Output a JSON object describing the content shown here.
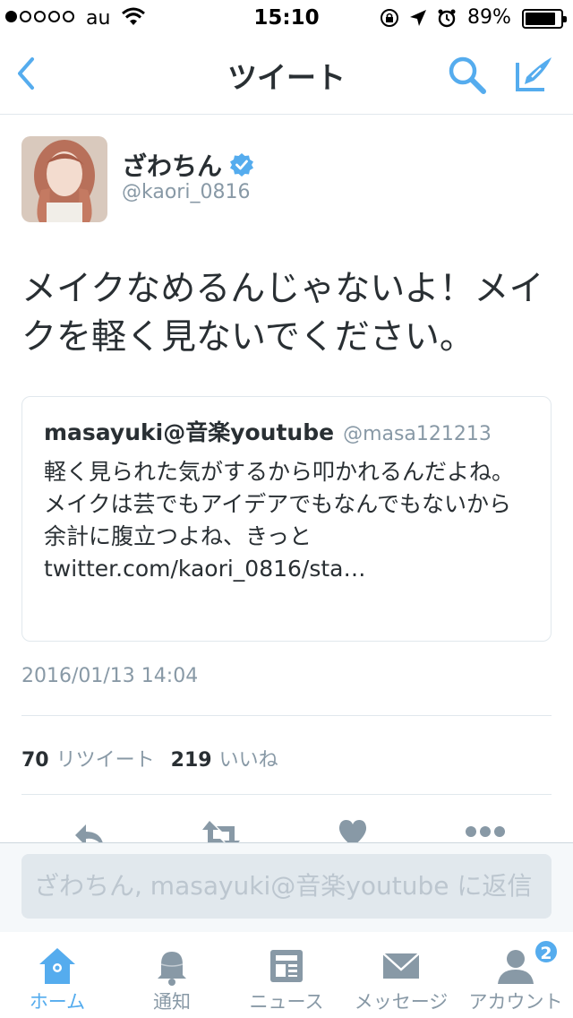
{
  "status_bar": {
    "carrier": "au",
    "time": "15:10",
    "battery": "89%",
    "battery_level": 0.89,
    "signal_bars_filled": 1,
    "signal_bars_total": 5
  },
  "nav": {
    "title": "ツイート",
    "back_icon": "chevron-left-icon",
    "search_icon": "search-icon",
    "compose_icon": "compose-icon"
  },
  "tweet": {
    "author_name": "ざわちん",
    "author_handle": "@kaori_0816",
    "verified": true,
    "text": "メイクなめるんじゃないよ！メイクを軽く見ないでください。",
    "timestamp": "2016/01/13 14:04",
    "retweets": "70",
    "retweets_label": "リツイート",
    "likes": "219",
    "likes_label": "いいね"
  },
  "quote": {
    "name": "masayuki@音楽youtube",
    "handle": "@masa121213",
    "text_line1": "軽く見られた気がするから叩かれるんだよね。",
    "text_line2": "メイクは芸でもアイデアでもなんでもないから余計に腹立つよね、きっと",
    "text_line3": "twitter.com/kaori_0816/sta…"
  },
  "reply": {
    "placeholder": "ざわちん, masayuki@音楽youtube に返信"
  },
  "tabs": [
    {
      "label": "ホーム",
      "icon": "home-icon",
      "active": true
    },
    {
      "label": "通知",
      "icon": "bell-icon",
      "active": false
    },
    {
      "label": "ニュース",
      "icon": "news-icon",
      "active": false
    },
    {
      "label": "メッセージ",
      "icon": "envelope-icon",
      "active": false
    },
    {
      "label": "アカウント",
      "icon": "person-icon",
      "active": false,
      "badge": "2"
    }
  ],
  "colors": {
    "accent": "#55acee",
    "text": "#292f33",
    "muted": "#8899a6",
    "border": "#e1e8ed"
  }
}
